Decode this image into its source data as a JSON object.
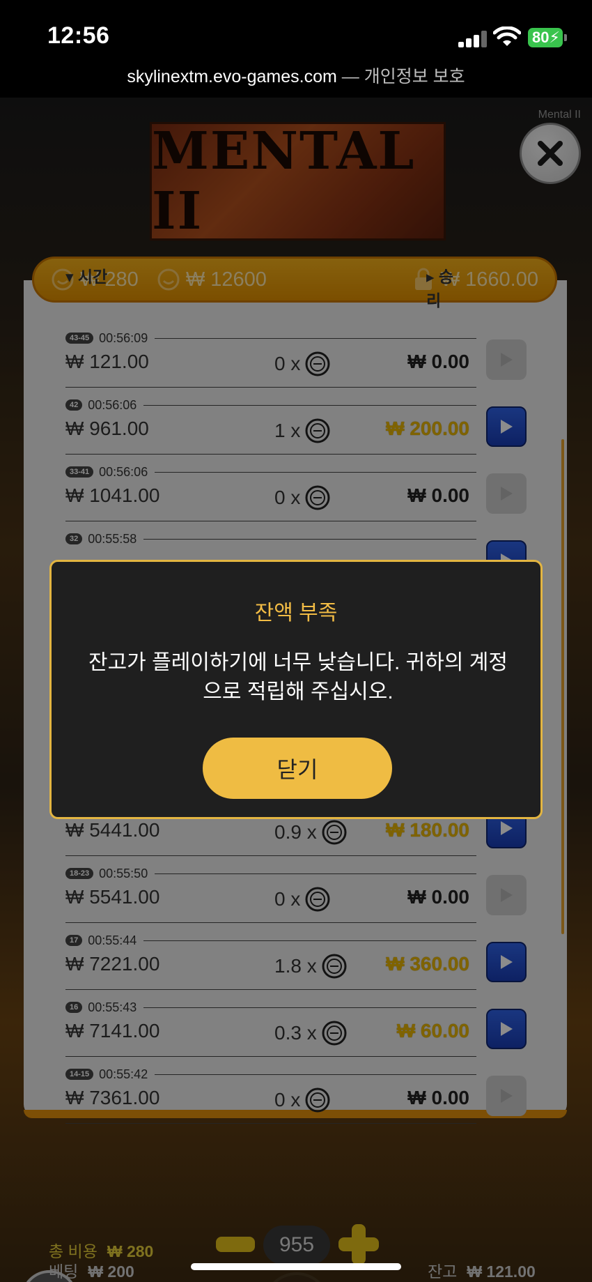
{
  "status_bar": {
    "time": "12:56",
    "battery": "80",
    "url": "skylinextm.evo-games.com",
    "privacy": " — 개인정보 보호"
  },
  "game": {
    "logo": "MENTAL II",
    "corner_label": "Mental II",
    "close_icon": "close-icon"
  },
  "balances": [
    {
      "icon": "smiley-coin-icon",
      "value": "₩ 280"
    },
    {
      "icon": "smiley-coin-icon",
      "value": "₩ 12600"
    },
    {
      "icon": "lock-icon",
      "value": "₩ 1660.00"
    }
  ],
  "history": {
    "header_time": "▾ 시간",
    "header_win": "▸ 승리",
    "rows": [
      {
        "round": "43-45",
        "time": "00:56:09",
        "bet": "₩ 121.00",
        "mult": "0 x",
        "win": "₩ 0.00",
        "highlight": false
      },
      {
        "round": "42",
        "time": "00:56:06",
        "bet": "₩ 961.00",
        "mult": "1 x",
        "win": "₩ 200.00",
        "highlight": true
      },
      {
        "round": "33-41",
        "time": "00:56:06",
        "bet": "₩ 1041.00",
        "mult": "0 x",
        "win": "₩ 0.00",
        "highlight": false
      },
      {
        "round": "32",
        "time": "00:55:58",
        "bet": "",
        "mult": "",
        "win": "",
        "highlight": true
      },
      {
        "round": "",
        "time": "",
        "bet": "",
        "mult": "",
        "win": "",
        "highlight": false
      },
      {
        "round": "",
        "time": "",
        "bet": "",
        "mult": "",
        "win": "",
        "highlight": false
      },
      {
        "round": "",
        "time": "",
        "bet": "",
        "mult": "",
        "win": "",
        "highlight": false
      },
      {
        "round": "",
        "time": "",
        "bet": "₩ 5441.00",
        "mult": "0.9 x",
        "win": "₩ 180.00",
        "highlight": true
      },
      {
        "round": "18-23",
        "time": "00:55:50",
        "bet": "₩ 5541.00",
        "mult": "0 x",
        "win": "₩ 0.00",
        "highlight": false
      },
      {
        "round": "17",
        "time": "00:55:44",
        "bet": "₩ 7221.00",
        "mult": "1.8 x",
        "win": "₩ 360.00",
        "highlight": true
      },
      {
        "round": "16",
        "time": "00:55:43",
        "bet": "₩ 7141.00",
        "mult": "0.3 x",
        "win": "₩ 60.00",
        "highlight": true
      },
      {
        "round": "14-15",
        "time": "00:55:42",
        "bet": "₩ 7361.00",
        "mult": "0 x",
        "win": "₩ 0.00",
        "highlight": false
      }
    ]
  },
  "modal": {
    "title": "잔액 부족",
    "message": "잔고가 플레이하기에 너무 낮습니다. 귀하의 계정으로 적립해 주십시오.",
    "button": "닫기"
  },
  "controls": {
    "bet_amount": "955",
    "total_cost_label": "총 비용",
    "total_cost_value": "₩ 280",
    "bet_label": "베팅",
    "bet_value": "₩ 200",
    "balance_label": "잔고",
    "balance_value": "₩ 121.00"
  },
  "colors": {
    "accent_gold": "#efbc43",
    "balance_bar": "#f5b11a",
    "play_active": "#2f63e8"
  }
}
